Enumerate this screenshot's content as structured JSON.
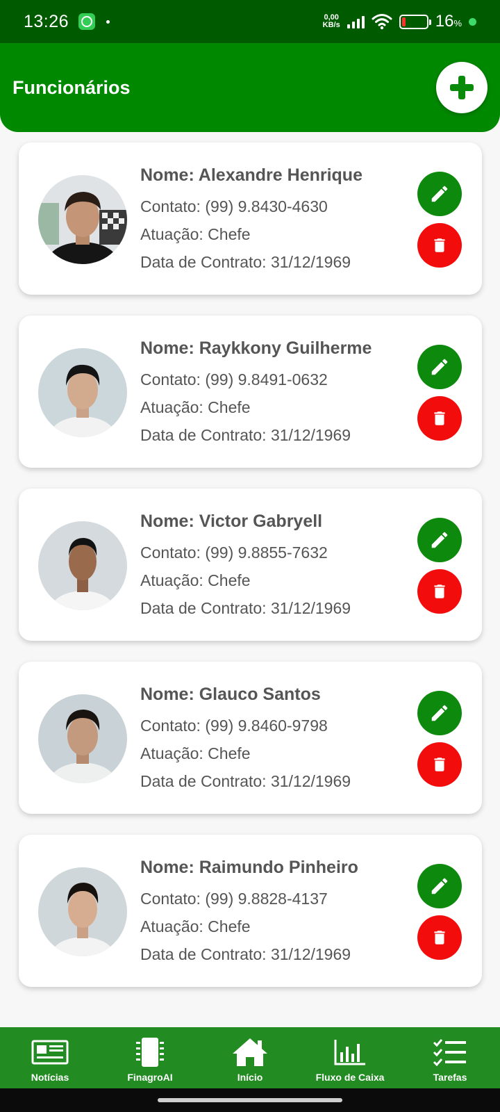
{
  "status_bar": {
    "time": "13:26",
    "net_speed_value": "0,00",
    "net_speed_unit": "KB/s",
    "battery_percent": "16",
    "battery_unit": "%",
    "battery_level": 0.16,
    "battery_color": "#ff3030"
  },
  "header": {
    "title": "Funcionários",
    "add_icon": "plus-icon",
    "color": "#008800"
  },
  "employees": [
    {
      "name": "Nome: Alexandre Henrique",
      "contact": "Contato: (99) 9.8430-4630",
      "role": "Atuação: Chefe",
      "contract": "Data de Contrato: 31/12/1969"
    },
    {
      "name": "Nome: Raykkony Guilherme",
      "contact": "Contato: (99) 9.8491-0632",
      "role": "Atuação: Chefe",
      "contract": "Data de Contrato: 31/12/1969"
    },
    {
      "name": "Nome: Victor Gabryell",
      "contact": "Contato: (99) 9.8855-7632",
      "role": "Atuação: Chefe",
      "contract": "Data de Contrato: 31/12/1969"
    },
    {
      "name": "Nome: Glauco Santos",
      "contact": "Contato: (99) 9.8460-9798",
      "role": "Atuação: Chefe",
      "contract": "Data de Contrato: 31/12/1969"
    },
    {
      "name": "Nome: Raimundo Pinheiro",
      "contact": "Contato: (99) 9.8828-4137",
      "role": "Atuação: Chefe",
      "contract": "Data de Contrato: 31/12/1969"
    }
  ],
  "actions": {
    "edit_icon": "pencil-icon",
    "edit_color": "#0d8a0d",
    "delete_icon": "trash-icon",
    "delete_color": "#f20c0c"
  },
  "bottom_nav": [
    {
      "label": "Notícias",
      "icon": "newspaper-icon"
    },
    {
      "label": "FinagroAI",
      "icon": "chip-icon"
    },
    {
      "label": "Início",
      "icon": "home-icon"
    },
    {
      "label": "Fluxo de Caixa",
      "icon": "bar-chart-icon"
    },
    {
      "label": "Tarefas",
      "icon": "checklist-icon"
    }
  ]
}
